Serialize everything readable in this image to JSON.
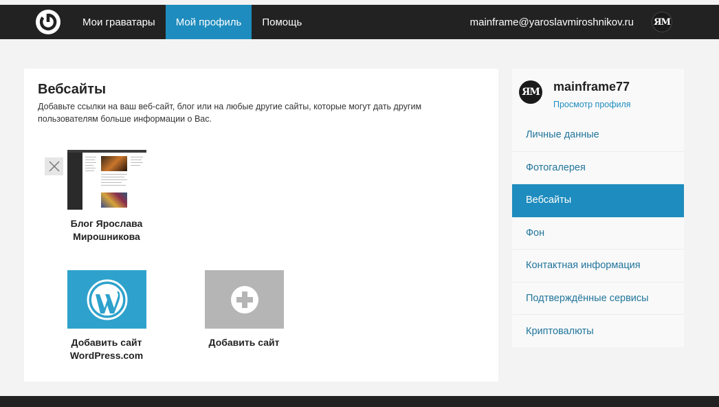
{
  "header": {
    "nav": [
      {
        "label": "Мои граватары",
        "active": false
      },
      {
        "label": "Мой профиль",
        "active": true
      },
      {
        "label": "Помощь",
        "active": false
      }
    ],
    "user_email": "mainframe@yaroslavmiroshnikov.ru",
    "avatar_text": "ЯМ"
  },
  "main": {
    "title": "Вебсайты",
    "description": "Добавьте ссылки на ваш веб-сайт, блог или на любые другие сайты, которые могут дать другим пользователям больше информации о Вас.",
    "sites": [
      {
        "label": "Блог Ярослава Мирошникова"
      }
    ],
    "add_tiles": [
      {
        "label": "Добавить сайт WordPress.com",
        "icon": "wordpress-icon"
      },
      {
        "label": "Добавить сайт",
        "icon": "plus-circle-icon"
      }
    ]
  },
  "sidebar": {
    "avatar_text": "ЯМ",
    "username": "mainframe77",
    "view_profile": "Просмотр профиля",
    "items": [
      {
        "label": "Личные данные",
        "active": false
      },
      {
        "label": "Фотогалерея",
        "active": false
      },
      {
        "label": "Вебсайты",
        "active": true
      },
      {
        "label": "Фон",
        "active": false
      },
      {
        "label": "Контактная информация",
        "active": false
      },
      {
        "label": "Подтверждённые сервисы",
        "active": false
      },
      {
        "label": "Криптовалюты",
        "active": false
      }
    ]
  },
  "colors": {
    "topbar": "#222222",
    "accent": "#1e8cbe",
    "wordpress_tile": "#2ea2cc",
    "add_tile": "#b5b5b5"
  }
}
